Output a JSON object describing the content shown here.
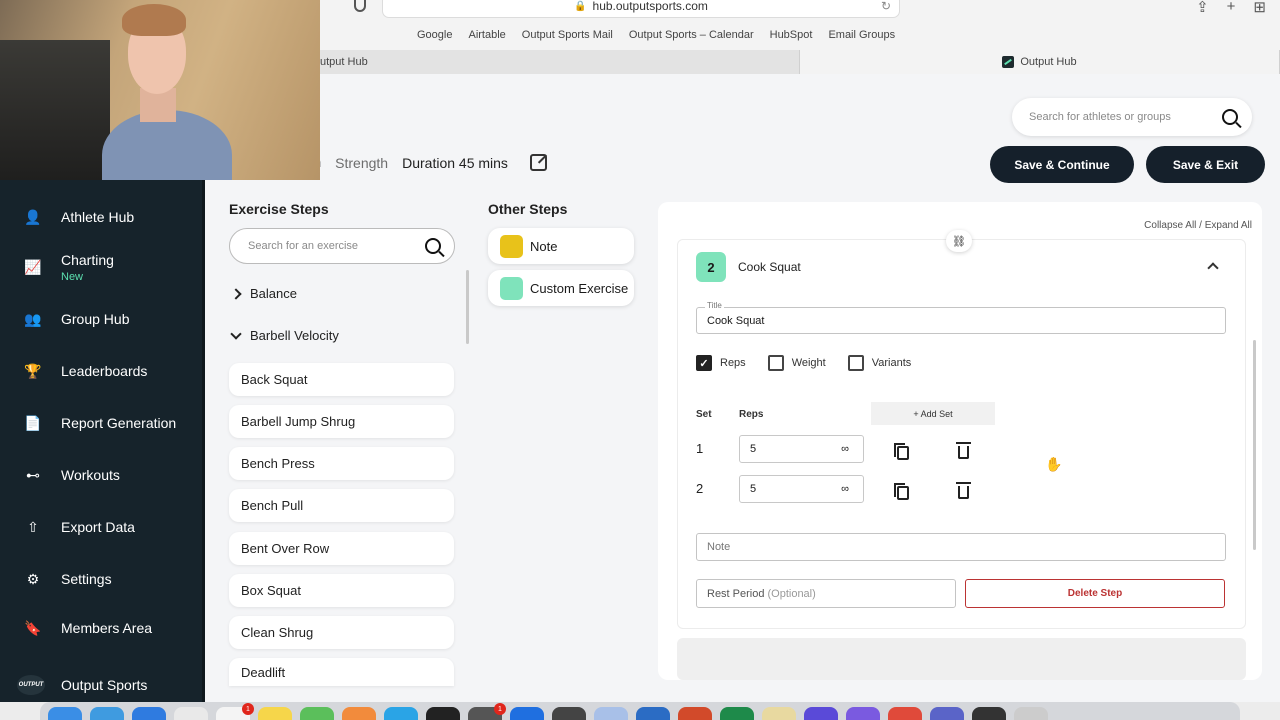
{
  "browser": {
    "url": "hub.outputsports.com",
    "bookmarks": [
      "Google",
      "Airtable",
      "Output Sports Mail",
      "Output Sports – Calendar",
      "HubSpot",
      "Email Groups"
    ],
    "tabs": [
      {
        "label": "utput Hub",
        "active": false
      },
      {
        "label": "Output Hub",
        "active": true
      }
    ]
  },
  "header": {
    "search_placeholder": "Search for athletes or groups",
    "workout_title_fragment": "n",
    "workout_type": "Strength",
    "duration": "Duration 45 mins",
    "save_continue": "Save & Continue",
    "save_exit": "Save & Exit"
  },
  "sidebar": {
    "items": [
      {
        "label": "Athlete Hub",
        "icon": "person-icon"
      },
      {
        "label": "Charting",
        "sub": "New",
        "icon": "chart-icon"
      },
      {
        "label": "Group Hub",
        "icon": "group-icon"
      },
      {
        "label": "Leaderboards",
        "icon": "trophy-icon"
      },
      {
        "label": "Report Generation",
        "icon": "report-icon"
      },
      {
        "label": "Workouts",
        "icon": "dumbbell-icon"
      },
      {
        "label": "Export Data",
        "icon": "export-icon"
      },
      {
        "label": "Settings",
        "icon": "gear-icon"
      },
      {
        "label": "Members Area",
        "icon": "bookmark-icon"
      },
      {
        "label": "Output Sports",
        "icon": "output-logo"
      }
    ],
    "logo_text": "OUTPUT"
  },
  "exercise_steps": {
    "title": "Exercise Steps",
    "search_placeholder": "Search for an exercise",
    "categories": [
      {
        "label": "Balance",
        "expanded": false
      },
      {
        "label": "Barbell Velocity",
        "expanded": true
      }
    ],
    "items": [
      "Back Squat",
      "Barbell Jump Shrug",
      "Bench Press",
      "Bench Pull",
      "Bent Over Row",
      "Box Squat",
      "Clean Shrug",
      "Deadlift"
    ]
  },
  "other_steps": {
    "title": "Other Steps",
    "items": [
      {
        "label": "Note",
        "color": "#e8c21a"
      },
      {
        "label": "Custom Exercise",
        "color": "#7fe3bb"
      }
    ]
  },
  "step_editor": {
    "collapse_expand": "Collapse All / Expand All",
    "step_number": "2",
    "step_name": "Cook Squat",
    "title_label": "Title",
    "title_value": "Cook Squat",
    "options": [
      {
        "label": "Reps",
        "checked": true
      },
      {
        "label": "Weight",
        "checked": false
      },
      {
        "label": "Variants",
        "checked": false
      }
    ],
    "set_header": "Set",
    "reps_header": "Reps",
    "add_set": "+ Add Set",
    "sets": [
      {
        "number": "1",
        "reps": "5"
      },
      {
        "number": "2",
        "reps": "5"
      }
    ],
    "infinity_symbol": "∞",
    "note_placeholder": "Note",
    "rest_label": "Rest Period",
    "rest_optional": "(Optional)",
    "delete_step": "Delete Step"
  },
  "dock": {
    "calendar_badge": "NOV",
    "badges": [
      "1",
      "1"
    ]
  }
}
